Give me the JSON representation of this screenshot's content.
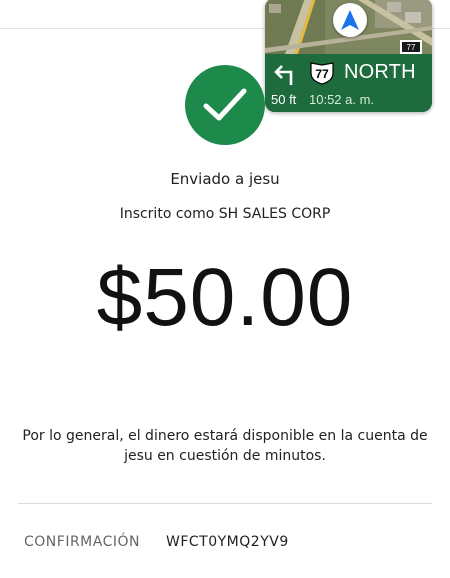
{
  "navigation": {
    "direction": "NORTH",
    "route_number": "77",
    "distance": "50 ft",
    "time": "10:52 a. m.",
    "map_route_sign": "77",
    "colors": {
      "bar": "#1e6b3e",
      "compass": "#1a73e8"
    },
    "icons": {
      "turn": "turn-left-icon",
      "compass": "navigation-arrow-icon"
    }
  },
  "confirmation_screen": {
    "check_icon": "checkmark-icon",
    "check_color": "#1d8a4c",
    "sent_to": "Enviado a jesu",
    "enrolled_as": "Inscrito como SH SALES CORP",
    "amount": "$50.00",
    "availability_message": "Por lo general, el dinero estará disponible en la cuenta de jesu en cuestión de minutos.",
    "confirmation_label": "CONFIRMACIÓN",
    "confirmation_code": "WFCT0YMQ2YV9"
  }
}
